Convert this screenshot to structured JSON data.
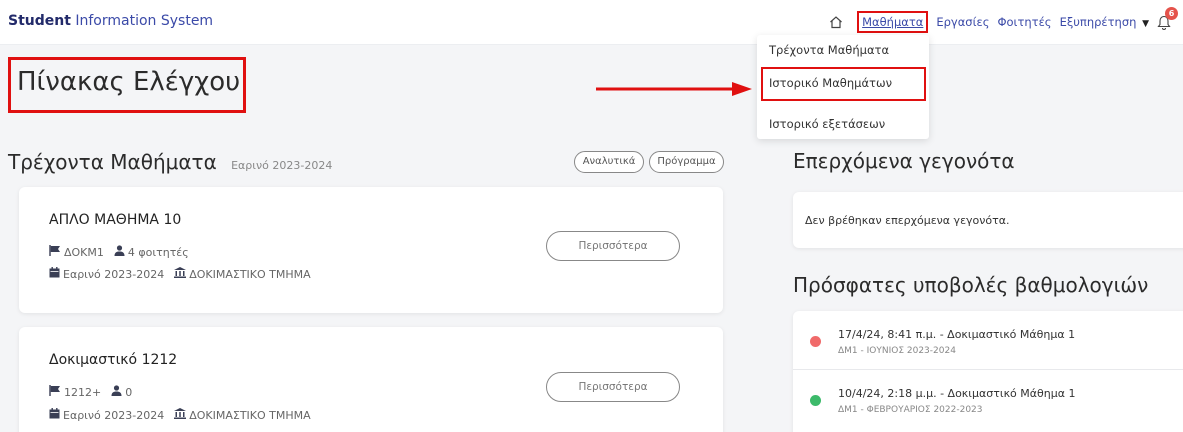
{
  "app": {
    "brand_strong": "Student",
    "brand_rest": "Information System"
  },
  "nav": {
    "home_icon": "home-icon",
    "items": [
      {
        "label": "Μαθήματα"
      },
      {
        "label": "Εργασίες"
      },
      {
        "label": "Φοιτητές"
      },
      {
        "label": "Εξυπηρέτηση"
      }
    ],
    "notifications_count": "6"
  },
  "dropdown": {
    "items": [
      {
        "label": "Τρέχοντα Μαθήματα"
      },
      {
        "label": "Ιστορικό Μαθημάτων"
      },
      {
        "label": "Ιστορικό εξετάσεων"
      }
    ]
  },
  "page": {
    "title": "Πίνακας Ελέγχου"
  },
  "current_courses": {
    "title": "Τρέχοντα Μαθήματα",
    "semester": "Εαρινό 2023-2024",
    "btn_analytics": "Αναλυτικά",
    "btn_schedule": "Πρόγραμμα",
    "courses": [
      {
        "name": "ΑΠΛΟ ΜΑΘΗΜΑ 10",
        "code": "ΔΟΚΜ1",
        "students": "4 φοιτητές",
        "semester": "Εαρινό 2023-2024",
        "department": "ΔΟΚΙΜΑΣΤΙΚΟ ΤΜΗΜΑ",
        "more_label": "Περισσότερα"
      },
      {
        "name": "Δοκιμαστικό 1212",
        "code": "1212+",
        "students": "0",
        "semester": "Εαρινό 2023-2024",
        "department": "ΔΟΚΙΜΑΣΤΙΚΟ ΤΜΗΜΑ",
        "more_label": "Περισσότερα"
      }
    ]
  },
  "upcoming_events": {
    "title": "Επερχόμενα γεγονότα",
    "empty_text": "Δεν βρέθηκαν επερχόμενα γεγονότα."
  },
  "recent_grades": {
    "title": "Πρόσφατες υποβολές βαθμολογιών",
    "items": [
      {
        "main": "17/4/24, 8:41 π.μ. - Δοκιμαστικό Μάθημα 1",
        "sub": "ΔΜ1 - ΙΟΥΝΙΟΣ 2023-2024",
        "status_color": "#f06a6a"
      },
      {
        "main": "10/4/24, 2:18 μ.μ. - Δοκιμαστικό Μάθημα 1",
        "sub": "ΔΜ1 - ΦΕΒΡΟΥΑΡΙΟΣ 2022-2023",
        "status_color": "#3cba6a"
      }
    ]
  },
  "colors": {
    "brand": "#2f3a86",
    "link": "#3b4aa8",
    "highlight_border": "#e01010",
    "badge": "#e5534b"
  }
}
